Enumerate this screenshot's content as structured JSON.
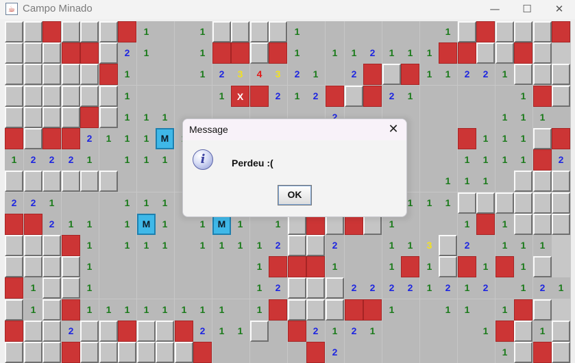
{
  "window": {
    "title": "Campo Minado",
    "controls": {
      "minimize": "—",
      "maximize": "☐",
      "close": "✕"
    }
  },
  "board": {
    "cols": 30,
    "legend": "r = unrevealed tile, . = revealed empty, R = red flagged tile, X = clicked mine, M = mine, 1-4 = adjacent mine count",
    "rows": [
      "rrRrrrR1..1rrrr1.......1rRrrrR",
      "rrrRRr21..1RRrR1.112111RRrrRr",
      "rrrrrR1...1234321.2RrR11221rrr",
      "rrrrrr1....1XR212RrR21.....1Rr",
      "rrrrRr111........2........111.1Rr",
      "RrRR2111M1..............R111rRr",
      "12221.111...............1111R211",
      "rrrrrr.................111.rrr",
      "221...111.........1..111rrrrrr",
      "RR211.1M1.1M1.1rRrRr1...1R1rrr",
      "rrrR1.111.11112rr2..113r2.111",
      "rrrr1........1RRR1..1R1rR1R1r",
      "R1rr1........12rrr22221212.121",
      "r1rR11111111.1RrrrRR1..11.1Rr",
      "Rrr2rrRrrR211r.R2121.....1Rr1r",
      "rrrRrrrrrrR.....R2........1rRr"
    ]
  },
  "number_colors": {
    "1": "#1a7a1a",
    "2": "#1e26e0",
    "3": "#f2e21e",
    "4": "#e01818",
    "X": "#ffffff",
    "M": "#0d1a26"
  },
  "dialog": {
    "title": "Message",
    "close": "✕",
    "icon_glyph": "i",
    "message": "Perdeu :(",
    "ok_label": "OK"
  }
}
